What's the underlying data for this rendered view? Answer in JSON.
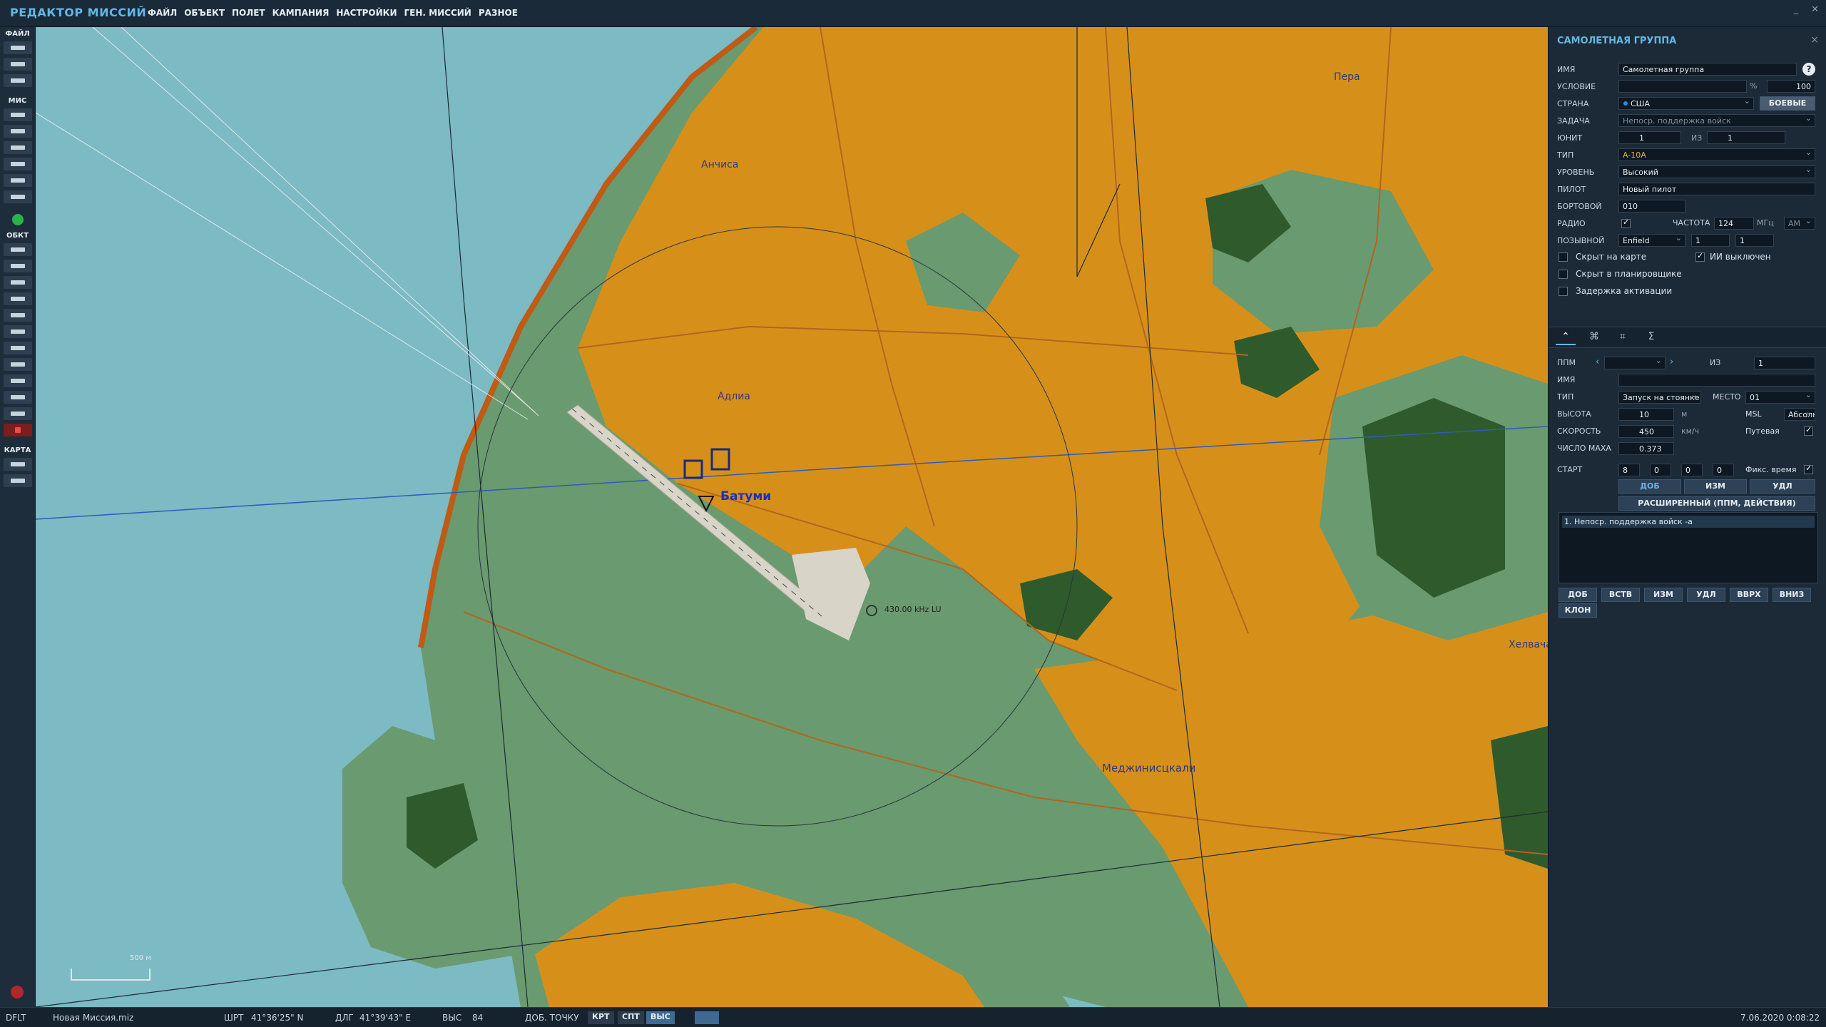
{
  "app": {
    "title": "РЕДАКТОР МИССИЙ"
  },
  "menu": [
    "ФАЙЛ",
    "ОБЪЕКТ",
    "ПОЛЕТ",
    "КАМПАНИЯ",
    "НАСТРОЙКИ",
    "ГЕН. МИССИЙ",
    "РАЗНОЕ"
  ],
  "window_buttons": {
    "minimize": "_",
    "close": "✕"
  },
  "toolbar": {
    "sections": {
      "file": "ФАЙЛ",
      "mission": "МИС",
      "objects": "ОБКТ",
      "map": "КАРТА"
    },
    "file_buttons": [
      "new-file-icon",
      "open-file-icon",
      "save-file-icon"
    ],
    "mission_buttons": [
      "briefing-icon",
      "weather-icon",
      "triggers-icon",
      "resources-icon",
      "goals-icon",
      "check-icon"
    ],
    "object_buttons": [
      "airplane-icon",
      "helicopter-icon",
      "ship-icon",
      "vehicle-icon",
      "static-icon",
      "nav-point-icon",
      "zone-icon",
      "bullseye-icon",
      "warehouse-icon",
      "route-icon",
      "shapes-icon",
      "delete-icon"
    ],
    "map_buttons": [
      "map-options-icon",
      "ruler-icon"
    ]
  },
  "map": {
    "labels": {
      "anchisa": "Анчиса",
      "adlia": "Адлиа",
      "batumi": "Батуми",
      "ndb": "430.00 kHz LU",
      "pera": "Пера",
      "meji": "Меджинисцкали",
      "khelvachauri": "Хелвачаури",
      "scale": "500 м"
    },
    "colors": {
      "water": "#7cbac4",
      "land": "#6a9a6f",
      "urban": "#d6901a",
      "roads": "#b3651e",
      "forest": "#2f5a2c"
    }
  },
  "panel": {
    "title": "САМОЛЕТНАЯ ГРУППА",
    "close": "×",
    "help": "?",
    "name": {
      "label": "ИМЯ",
      "value": "Самолетная группа"
    },
    "condition": {
      "label": "УСЛОВИЕ",
      "value": "",
      "percent_sign": "%",
      "percent": "100"
    },
    "country": {
      "label": "СТРАНА",
      "value": "США",
      "combat_button": "БОЕВЫЕ"
    },
    "task": {
      "label": "ЗАДАЧА",
      "value": "Непоср. поддержка войск"
    },
    "unit": {
      "label": "ЮНИТ",
      "value": "1",
      "of_label": "ИЗ",
      "of_value": "1"
    },
    "type": {
      "label": "ТИП",
      "value": "A-10A"
    },
    "skill": {
      "label": "УРОВЕНЬ",
      "value": "Высокий"
    },
    "pilot": {
      "label": "ПИЛОТ",
      "value": "Новый пилот"
    },
    "tail": {
      "label": "БОРТОВОЙ",
      "value": "010"
    },
    "radio": {
      "label": "РАДИО",
      "freq_label": "ЧАСТОТА",
      "freq_value": "124",
      "unit": "МГц",
      "modulation": "AM"
    },
    "callsign": {
      "label": "ПОЗЫВНОЙ",
      "value": "Enfield",
      "n1": "1",
      "n2": "1"
    },
    "checks": {
      "hidden_map": "Скрыт на карте",
      "ai_off": "ИИ выключен",
      "hidden_planner": "Скрыт в планировщике",
      "late_activation": "Задержка активации"
    },
    "tabs": [
      "route-tab-icon",
      "targets-tab-icon",
      "payload-tab-icon",
      "summary-tab-icon"
    ],
    "wp": {
      "label": "ППМ",
      "of_label": "ИЗ",
      "of_value": "1",
      "name_label": "ИМЯ",
      "name_value": "",
      "type_label": "ТИП",
      "type_value": "Запуск на стоянке",
      "place_label": "МЕСТО",
      "place_value": "01",
      "alt_label": "ВЫСОТА",
      "alt_value": "10",
      "alt_unit": "м",
      "alt_ref": "MSL",
      "alt_abs": "Абсолют",
      "speed_label": "СКОРОСТЬ",
      "speed_value": "450",
      "speed_unit": "км/ч",
      "speed_ref": "Путевая",
      "mach_label": "ЧИСЛО МАХА",
      "mach_value": "0.373",
      "start_label": "СТАРТ",
      "start_d": "8",
      "start_h": "0",
      "start_m": "0",
      "start_s": "0",
      "fixed_time": "Фикс. время",
      "add": "ДОБ",
      "edit": "ИЗМ",
      "del": "УДЛ",
      "advanced": "РАСШИРЕННЫЙ (ППМ, ДЕЙСТВИЯ)"
    },
    "actions": {
      "items": [
        "1. Непоср. поддержка войск -а"
      ],
      "buttons": [
        "ДОБ",
        "ВСТВ",
        "ИЗМ",
        "УДЛ",
        "ВВРХ",
        "ВНИЗ",
        "КЛОН"
      ]
    }
  },
  "status": {
    "profile": "DFLT",
    "file": "Новая Миссия.miz",
    "lat_label": "ШРТ",
    "lat": "41°36'25\" N",
    "lon_label": "ДЛГ",
    "lon": "41°39'43\" E",
    "alt_label": "ВЫС",
    "alt": "84",
    "add_point": "ДОБ. ТОЧКУ",
    "modes": [
      "КРТ",
      "СПТ",
      "ВЫС"
    ],
    "datetime": "7.06.2020 0:08:22"
  }
}
